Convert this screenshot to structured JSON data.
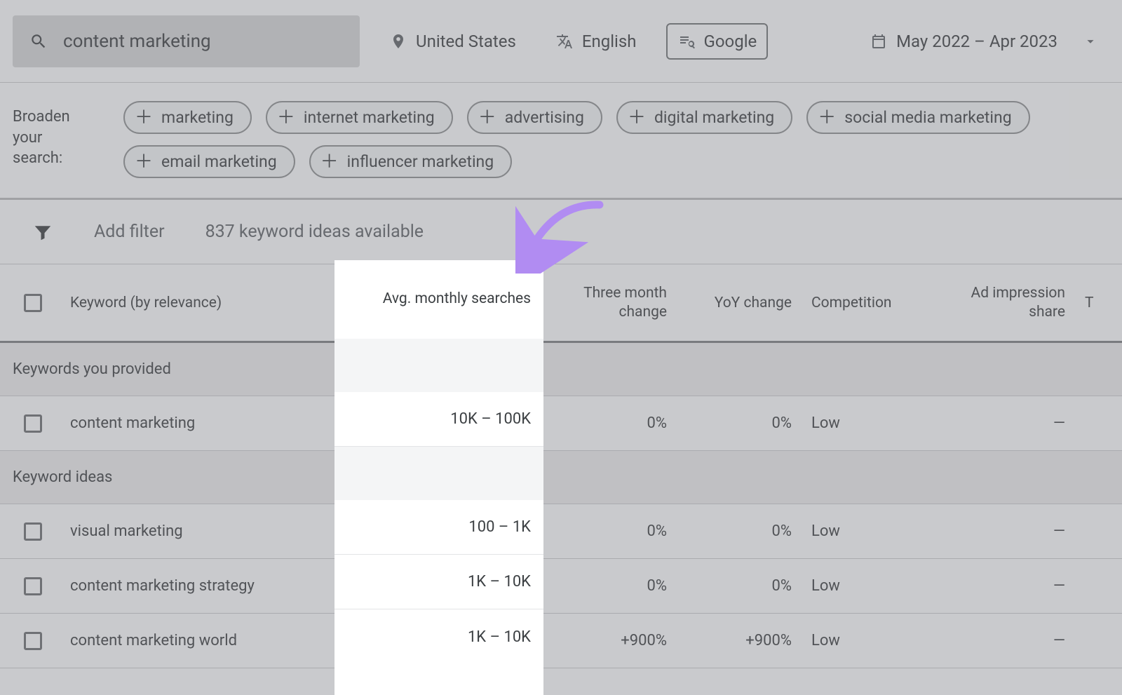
{
  "top": {
    "search_value": "content marketing",
    "location": "United States",
    "language": "English",
    "network": "Google",
    "date_range": "May 2022 – Apr 2023"
  },
  "broaden": {
    "label_line1": "Broaden your",
    "label_line2": "search:",
    "chips": [
      "marketing",
      "internet marketing",
      "advertising",
      "digital marketing",
      "social media marketing",
      "email marketing",
      "influencer marketing"
    ]
  },
  "filter": {
    "add_filter": "Add filter",
    "count_text": "837 keyword ideas available"
  },
  "columns": {
    "keyword": "Keyword (by relevance)",
    "avg": "Avg. monthly searches",
    "three_mo_l1": "Three month",
    "three_mo_l2": "change",
    "yoy": "YoY change",
    "comp": "Competition",
    "ad_l1": "Ad impression",
    "ad_l2": "share",
    "truncated": "T"
  },
  "sections": {
    "provided": "Keywords you provided",
    "ideas": "Keyword ideas"
  },
  "rows_provided": [
    {
      "kw": "content marketing",
      "avg": "10K – 100K",
      "m3": "0%",
      "yoy": "0%",
      "comp": "Low",
      "ad": "—"
    }
  ],
  "rows_ideas": [
    {
      "kw": "visual marketing",
      "avg": "100 – 1K",
      "m3": "0%",
      "yoy": "0%",
      "comp": "Low",
      "ad": "—"
    },
    {
      "kw": "content marketing strategy",
      "avg": "1K – 10K",
      "m3": "0%",
      "yoy": "0%",
      "comp": "Low",
      "ad": "—"
    },
    {
      "kw": "content marketing world",
      "avg": "1K – 10K",
      "m3": "+900%",
      "yoy": "+900%",
      "comp": "Low",
      "ad": "—"
    }
  ],
  "colors": {
    "arrow": "#b18cf2"
  }
}
